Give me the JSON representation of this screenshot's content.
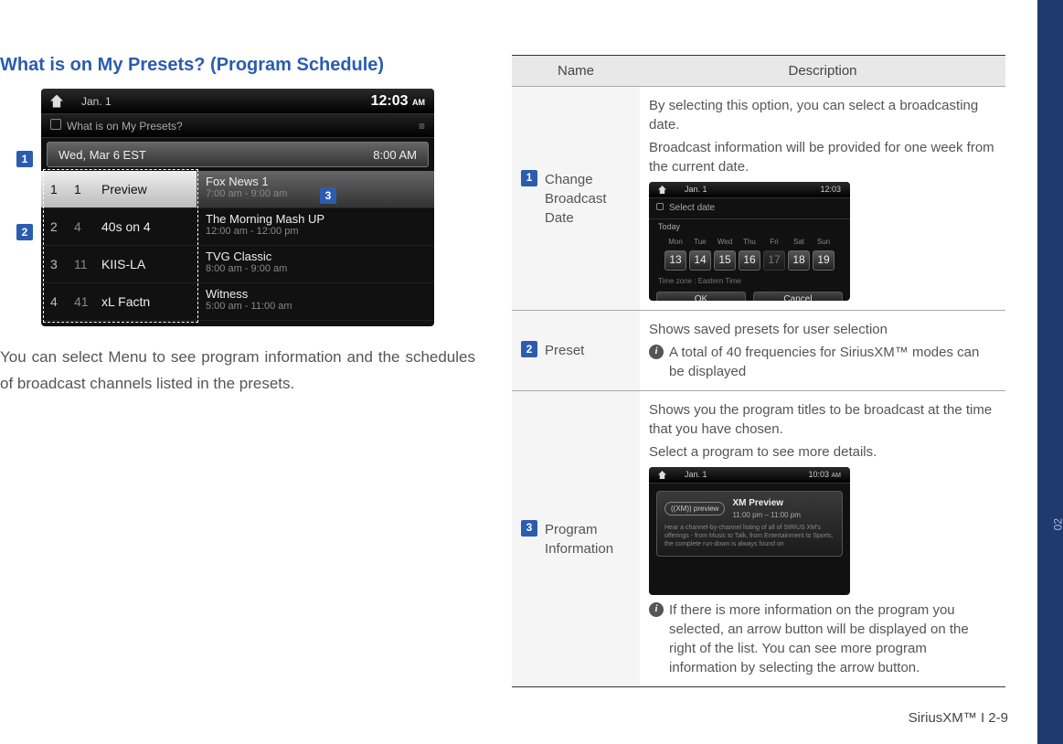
{
  "section_title": "What is on My Presets? (Program Schedule)",
  "intro": "You can select Menu to see program information and the schedules of broadcast channels listed in the presets.",
  "footer": "SiriusXM™ I 2-9",
  "side_tab": "02",
  "main_mock": {
    "date": "Jan. 1",
    "clock": "12:03",
    "ampm": "AM",
    "subtitle": "What is on My Presets?",
    "bar_date": "Wed, Mar 6 EST",
    "bar_time": "8:00 AM",
    "rows": [
      {
        "preset": "1",
        "ch": "1",
        "name": "Preview",
        "title": "Fox News 1",
        "time": "7:00 am - 9:00 am"
      },
      {
        "preset": "2",
        "ch": "4",
        "name": "40s on 4",
        "title": "The Morning Mash UP",
        "time": "12:00 am - 12:00 pm"
      },
      {
        "preset": "3",
        "ch": "11",
        "name": "KIIS-LA",
        "title": "TVG Classic",
        "time": "8:00 am - 9:00 am"
      },
      {
        "preset": "4",
        "ch": "41",
        "name": "xL Factn",
        "title": "Witness",
        "time": "5:00 am - 11:00 am"
      }
    ]
  },
  "table": {
    "head_name": "Name",
    "head_desc": "Description",
    "rows": [
      {
        "num": "1",
        "name": "Change Broadcast Date",
        "desc1": "By selecting this option, you can select a broadcasting date.",
        "desc2": "Broadcast information will be provided for one week from the current date."
      },
      {
        "num": "2",
        "name": "Preset",
        "desc1": "Shows saved presets for user selection",
        "info": "A total of 40 frequencies for SiriusXM™ modes can be displayed"
      },
      {
        "num": "3",
        "name": "Program Information",
        "desc1": "Shows you the program titles to be broadcast at the time that you have chosen.",
        "desc2": "Select a program to see more details.",
        "info": "If there is more information on the program you selected, an arrow button will be displayed on the right of the list. You can see more program information by selecting the arrow button."
      }
    ]
  },
  "date_mock": {
    "header": "Select date",
    "today": "Today",
    "dow": [
      "Mon",
      "Tue",
      "Wed",
      "Thu",
      "Fri",
      "Sat",
      "Sun"
    ],
    "days": [
      "13",
      "14",
      "15",
      "16",
      "17",
      "18",
      "19"
    ],
    "tz": "Time zone : Eastern Time",
    "ok": "OK",
    "cancel": "Cancel"
  },
  "prog_mock": {
    "date": "Jan. 1",
    "clock": "10:03",
    "ampm": "AM",
    "logo": "((XM)) preview",
    "title": "XM Preview",
    "time": "11:00 pm – 11:00 pm",
    "desc": "Hear a channel-by-channel listing of all of SIRIUS XM's offerings - from Music to Talk, from Entertainment to Sports, the complete run-down is always found on"
  }
}
